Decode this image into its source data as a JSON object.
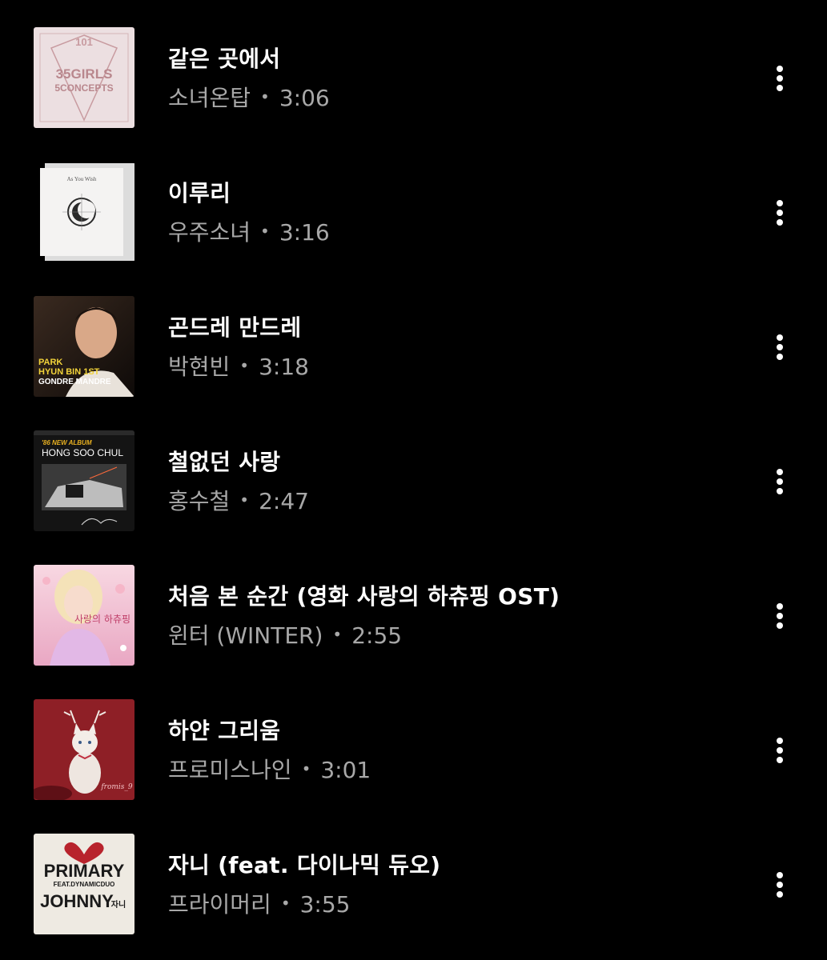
{
  "tracks": [
    {
      "title": "같은 곳에서",
      "artist": "소녀온탑",
      "separator": "•",
      "duration": "3:06",
      "cover": {
        "icon": "album-cover-35girls",
        "lines": [
          "101",
          "35GIRLS",
          "5CONCEPTS"
        ],
        "accent": "#c89ba0",
        "background": "#ecdfe1"
      }
    },
    {
      "title": "이루리",
      "artist": "우주소녀",
      "separator": "•",
      "duration": "3:16",
      "cover": {
        "icon": "album-cover-as-you-wish",
        "lines": [
          "As You Wish"
        ],
        "accent": "#2a2a2a",
        "background": "#f4f3f2"
      }
    },
    {
      "title": "곤드레 만드레",
      "artist": "박현빈",
      "separator": "•",
      "duration": "3:18",
      "cover": {
        "icon": "album-cover-park-hyun-bin",
        "lines": [
          "PARK",
          "HYUN BIN 1ST",
          "GONDRE MANDRE"
        ],
        "accent": "#f2d33a",
        "background": "#1c1410"
      }
    },
    {
      "title": "철없던 사랑",
      "artist": "홍수철",
      "separator": "•",
      "duration": "2:47",
      "cover": {
        "icon": "album-cover-hong-soo-chul",
        "lines": [
          "'86 NEW ALBUM",
          "HONG SOO CHUL"
        ],
        "accent": "#e8b020",
        "background": "#141414"
      }
    },
    {
      "title": "처음 본 순간 (영화 사랑의 하츄핑 OST)",
      "artist": "윈터 (WINTER)",
      "separator": "•",
      "duration": "2:55",
      "cover": {
        "icon": "album-cover-catch-teenieping",
        "lines": [
          "사랑의 하츄핑"
        ],
        "accent": "#d46a92",
        "background": "#f4c7d6"
      }
    },
    {
      "title": "하얀 그리움",
      "artist": "프로미스나인",
      "separator": "•",
      "duration": "3:01",
      "cover": {
        "icon": "album-cover-white-cat",
        "lines": [
          "fromis_9"
        ],
        "accent": "#f0e8e2",
        "background": "#8e1f26"
      }
    },
    {
      "title": "자니 (feat. 다이나믹 듀오)",
      "artist": "프라이머리",
      "separator": "•",
      "duration": "3:55",
      "cover": {
        "icon": "album-cover-primary-johnny",
        "lines": [
          "PRIMARY",
          "FEAT.DYNAMICDUO",
          "JOHNNY",
          "자니"
        ],
        "accent": "#b8232c",
        "background": "#eeeae2"
      }
    }
  ],
  "more_icon": "more-vertical-icon",
  "colors": {
    "background": "#000000",
    "title": "#ffffff",
    "subtitle": "#a8a8a8"
  }
}
